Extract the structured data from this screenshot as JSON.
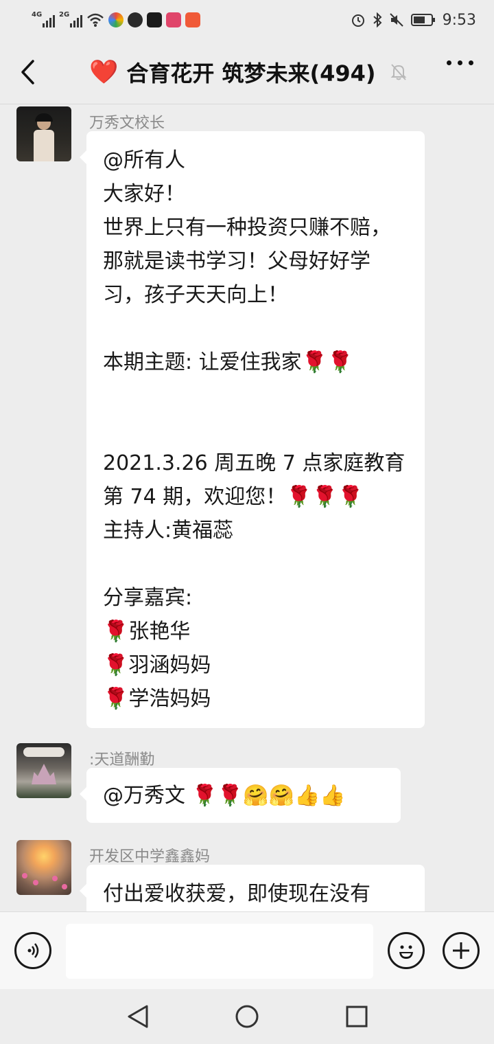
{
  "status_bar": {
    "signal1_label": "4G",
    "signal2_label": "2G",
    "time": "9:53"
  },
  "nav": {
    "title_emoji": "❤️",
    "title": "合育花开 筑梦未来(494)"
  },
  "messages": [
    {
      "sender": "万秀文校长",
      "lines": [
        "@所有人",
        "大家好！",
        "世界上只有一种投资只赚不赔，",
        "那就是读书学习！父母好好学",
        "习，孩子天天向上！",
        "",
        "本期主题: 让爱住我家🌹🌹",
        "",
        "",
        "2021.3.26 周五晚 7 点家庭教育",
        "第 74 期，欢迎您！🌹🌹🌹",
        "主持人:黄福蕊",
        "",
        "分享嘉宾:",
        "🌹张艳华",
        "🌹羽涵妈妈",
        "🌹学浩妈妈"
      ]
    },
    {
      "sender": ":天道酬勤",
      "lines": [
        "@万秀文 🌹🌹🤗🤗👍👍"
      ]
    },
    {
      "sender": "开发区中学鑫鑫妈",
      "lines": [
        "付出爱收获爱，即使现在没有"
      ]
    }
  ],
  "input": {
    "value": "",
    "placeholder": ""
  },
  "colors": {
    "background": "#ededed",
    "bubble": "#ffffff",
    "sender_text": "#8a8a8a"
  },
  "icons": [
    "back-arrow-icon",
    "heart-icon",
    "mute-bell-icon",
    "more-icon",
    "voice-icon",
    "emoji-icon",
    "plus-icon",
    "nav-back-icon",
    "nav-home-icon",
    "nav-recent-icon"
  ]
}
